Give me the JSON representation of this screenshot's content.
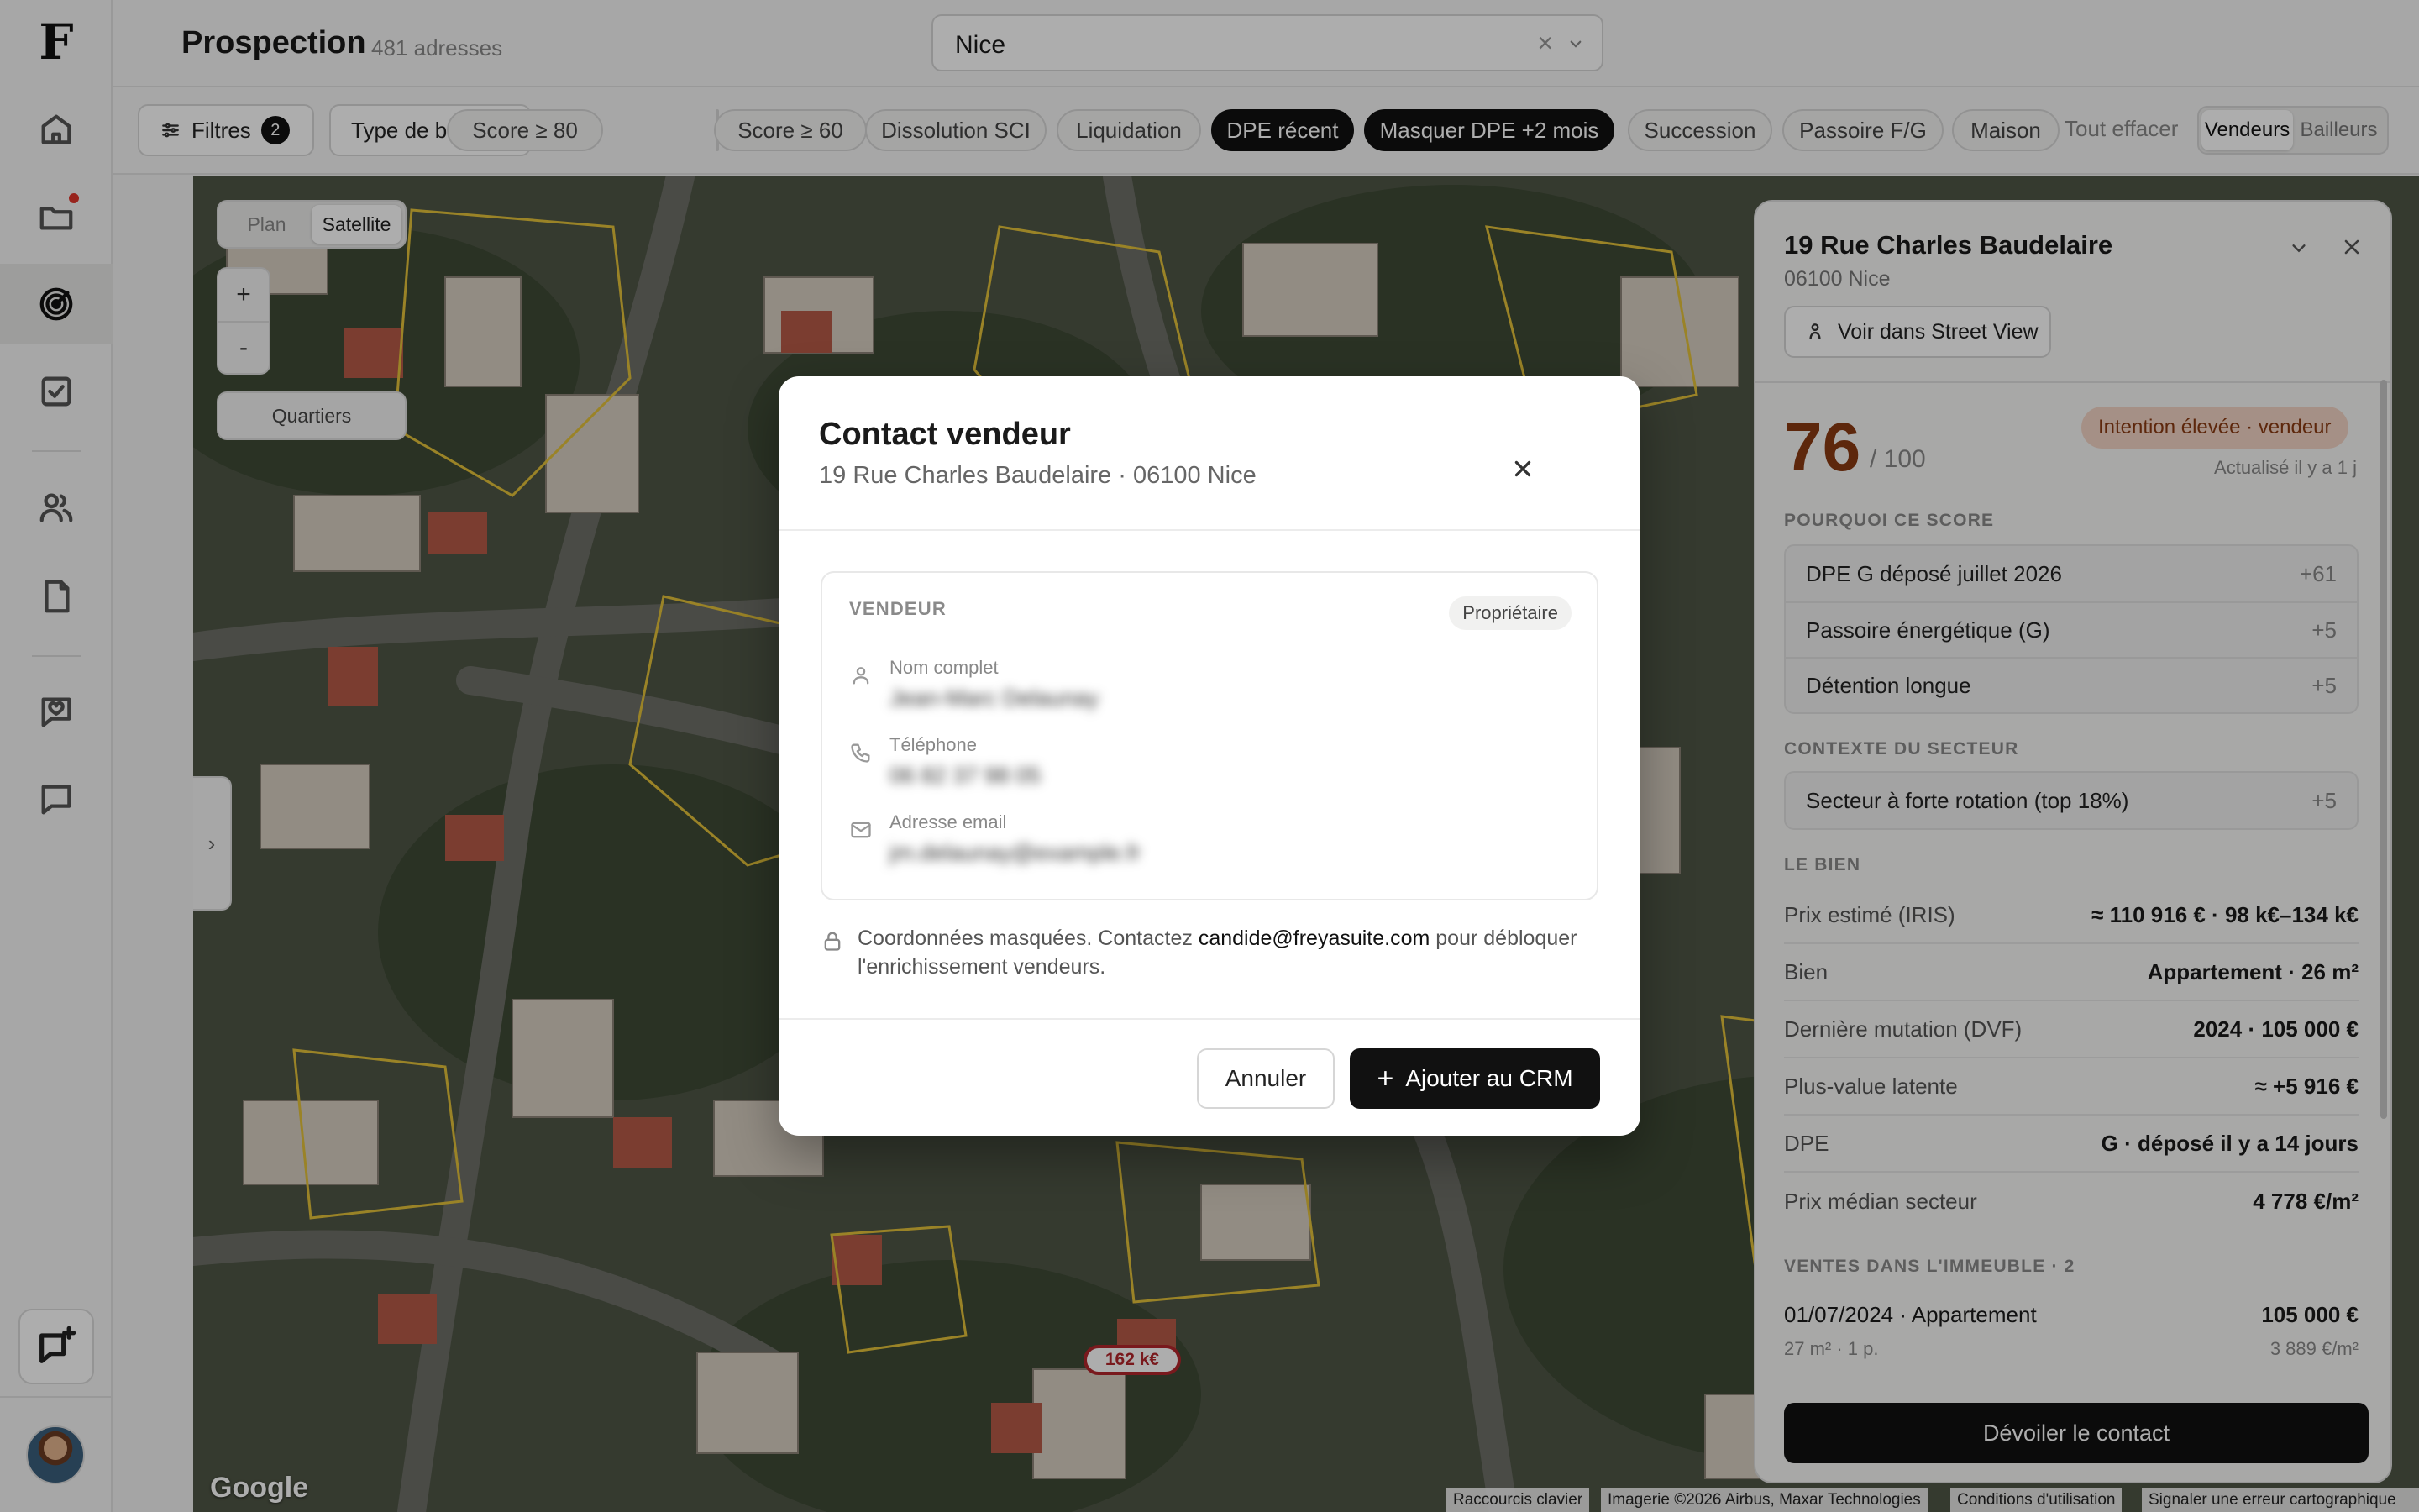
{
  "app": {
    "logo": "F"
  },
  "header": {
    "title": "Prospection",
    "count": "481 adresses",
    "city": {
      "value": "Nice",
      "clear": "×"
    }
  },
  "filters": {
    "filters_label": "Filtres",
    "filters_count": "2",
    "property_type": "Type de bien",
    "chips": [
      "Score ≥ 80",
      "Score ≥ 60",
      "Dissolution SCI",
      "Liquidation",
      "DPE récent",
      "Masquer DPE +2 mois",
      "Succession",
      "Passoire F/G",
      "Maison"
    ],
    "active_chips": [
      "DPE récent",
      "Masquer DPE +2 mois"
    ],
    "clear_all": "Tout effacer",
    "mode": {
      "options": [
        "Vendeurs",
        "Bailleurs"
      ],
      "selected": "Vendeurs"
    }
  },
  "map": {
    "type_options": [
      "Plan",
      "Satellite"
    ],
    "type_selected": "Satellite",
    "zoom_in": "+",
    "zoom_out": "-",
    "quartiers": "Quartiers",
    "price_tag": "162 k€",
    "google": "Google",
    "attribution": [
      "Raccourcis clavier",
      "Imagerie ©2026 Airbus, Maxar Technologies",
      "Conditions d'utilisation",
      "Signaler une erreur cartographique"
    ],
    "toggle": "›"
  },
  "panel": {
    "title": "19 Rue Charles Baudelaire",
    "subtitle": "06100 Nice",
    "street_view": "Voir dans Street View",
    "score": "76",
    "score_of": "/ 100",
    "intent": "Intention élevée · vendeur",
    "updated": "Actualisé il y a 1 j",
    "why_title": "POURQUOI CE SCORE",
    "reasons": [
      {
        "label": "DPE G déposé juillet 2026",
        "pts": "+61"
      },
      {
        "label": "Passoire énergétique (G)",
        "pts": "+5"
      },
      {
        "label": "Détention longue",
        "pts": "+5"
      }
    ],
    "context_title": "CONTEXTE DU SECTEUR",
    "context": [
      {
        "label": "Secteur à forte rotation (top 18%)",
        "pts": "+5"
      }
    ],
    "property_title": "LE BIEN",
    "property": [
      {
        "k": "Prix estimé (IRIS)",
        "v": "≈ 110 916 € · 98 k€–134 k€"
      },
      {
        "k": "Bien",
        "v": "Appartement · 26 m²"
      },
      {
        "k": "Dernière mutation (DVF)",
        "v": "2024 · 105 000 €"
      },
      {
        "k": "Plus-value latente",
        "v": "≈ +5 916 €"
      },
      {
        "k": "DPE",
        "v": "G · déposé il y a 14 jours"
      },
      {
        "k": "Prix médian secteur",
        "v": "4 778 €/m²"
      }
    ],
    "sales_title": "VENTES DANS L'IMMEUBLE · 2",
    "sale": {
      "title": "01/07/2024 · Appartement",
      "price": "105 000 €",
      "details": "27 m² · 1 p.",
      "price_m2": "3 889 €/m²"
    },
    "reveal": "Dévoiler le contact"
  },
  "modal": {
    "title": "Contact vendeur",
    "subtitle": "19 Rue Charles Baudelaire · 06100 Nice",
    "card_label": "VENDEUR",
    "role": "Propriétaire",
    "fields": [
      {
        "label": "Nom complet",
        "value": "Jean-Marc Delaunay"
      },
      {
        "label": "Téléphone",
        "value": "06 82 37 98 05"
      },
      {
        "label": "Adresse email",
        "value": "jm.delaunay@example.fr"
      }
    ],
    "note_prefix": "Coordonnées masquées. Contactez ",
    "note_email": "candide@freyasuite.com",
    "note_suffix": " pour débloquer l'enrichissement vendeurs.",
    "cancel": "Annuler",
    "add": "Ajouter au CRM"
  }
}
